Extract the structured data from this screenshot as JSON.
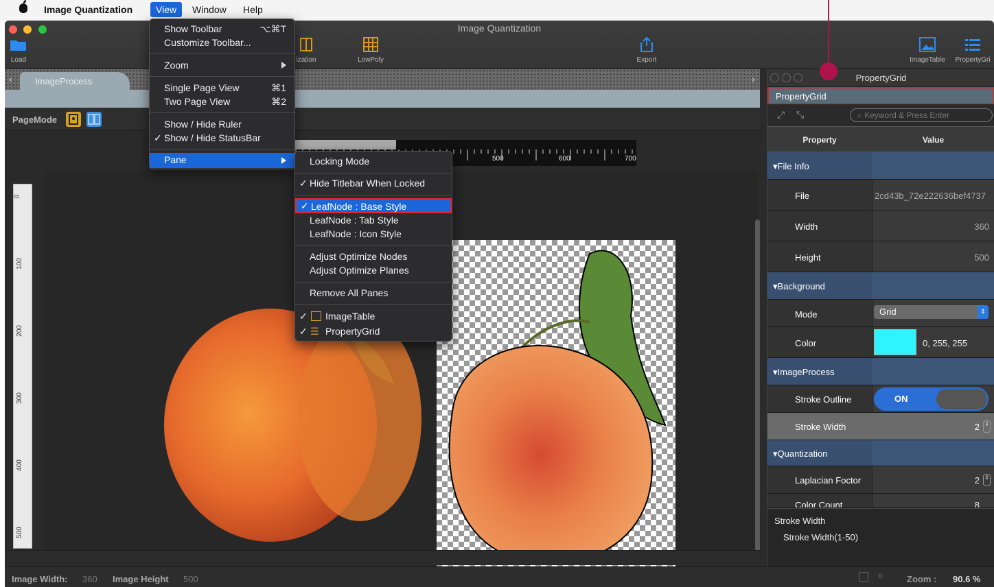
{
  "menubar": {
    "app_name": "Image Quantization",
    "items": [
      "View",
      "Window",
      "Help"
    ]
  },
  "window": {
    "title": "Image Quantization",
    "toolbar": {
      "load": "Load",
      "quantization": "ization",
      "lowpoly": "LowPoly",
      "export": "Export",
      "imagetable": "ImageTable",
      "propertygrid": "PropertyGri"
    },
    "tab": "ImageProcess",
    "pagemode_label": "PageMode"
  },
  "ruler": {
    "h_labels": [
      "500",
      "600",
      "700"
    ],
    "v_labels": [
      "0",
      "100",
      "200",
      "300",
      "400",
      "500"
    ]
  },
  "view_menu": {
    "show_toolbar": "Show Toolbar",
    "show_toolbar_shortcut": "⌥⌘T",
    "customize_toolbar": "Customize Toolbar...",
    "zoom": "Zoom",
    "single_page": "Single Page View",
    "single_page_shortcut": "⌘1",
    "two_page": "Two Page View",
    "two_page_shortcut": "⌘2",
    "show_ruler": "Show / Hide Ruler",
    "show_statusbar": "Show / Hide StatusBar",
    "pane": "Pane"
  },
  "pane_menu": {
    "locking_mode": "Locking Mode",
    "hide_titlebar": "Hide Titlebar When Locked",
    "leaf_base": "LeafNode : Base Style",
    "leaf_tab": "LeafNode : Tab Style",
    "leaf_icon": "LeafNode : Icon Style",
    "adjust_nodes": "Adjust Optimize Nodes",
    "adjust_planes": "Adjust Optimize Planes",
    "remove_all": "Remove All Panes",
    "image_table": "ImageTable",
    "property_grid": "PropertyGrid"
  },
  "panel": {
    "title": "PropertyGrid",
    "tab": "PropertyGrid",
    "search_placeholder": "Keyword & Press Enter",
    "col_property": "Property",
    "col_value": "Value",
    "sections": {
      "file_info": "File Info",
      "background": "Background",
      "image_process": "ImageProcess",
      "quantization": "Quantization"
    },
    "rows": {
      "file": {
        "k": "File",
        "v": "2cd43b_72e222636bef4737"
      },
      "width": {
        "k": "Width",
        "v": "360"
      },
      "height": {
        "k": "Height",
        "v": "500"
      },
      "mode": {
        "k": "Mode",
        "v": "Grid"
      },
      "color": {
        "k": "Color",
        "v": "0, 255, 255"
      },
      "stroke_outline": {
        "k": "Stroke Outline",
        "v": "ON"
      },
      "stroke_width": {
        "k": "Stroke Width",
        "v": "2"
      },
      "laplacian": {
        "k": "Laplacian Foctor",
        "v": "2"
      },
      "color_count": {
        "k": "Color Count",
        "v": "8"
      }
    },
    "footer_title": "Stroke Width",
    "footer_desc": "Stroke Width(1-50)",
    "color_swatch": "#2ff3ff"
  },
  "status": {
    "width_label": "Image Width:",
    "width_value": "360",
    "height_label": "Image Height",
    "height_value": "500",
    "zoom_label": "Zoom :",
    "zoom_value": "90.6 %"
  }
}
